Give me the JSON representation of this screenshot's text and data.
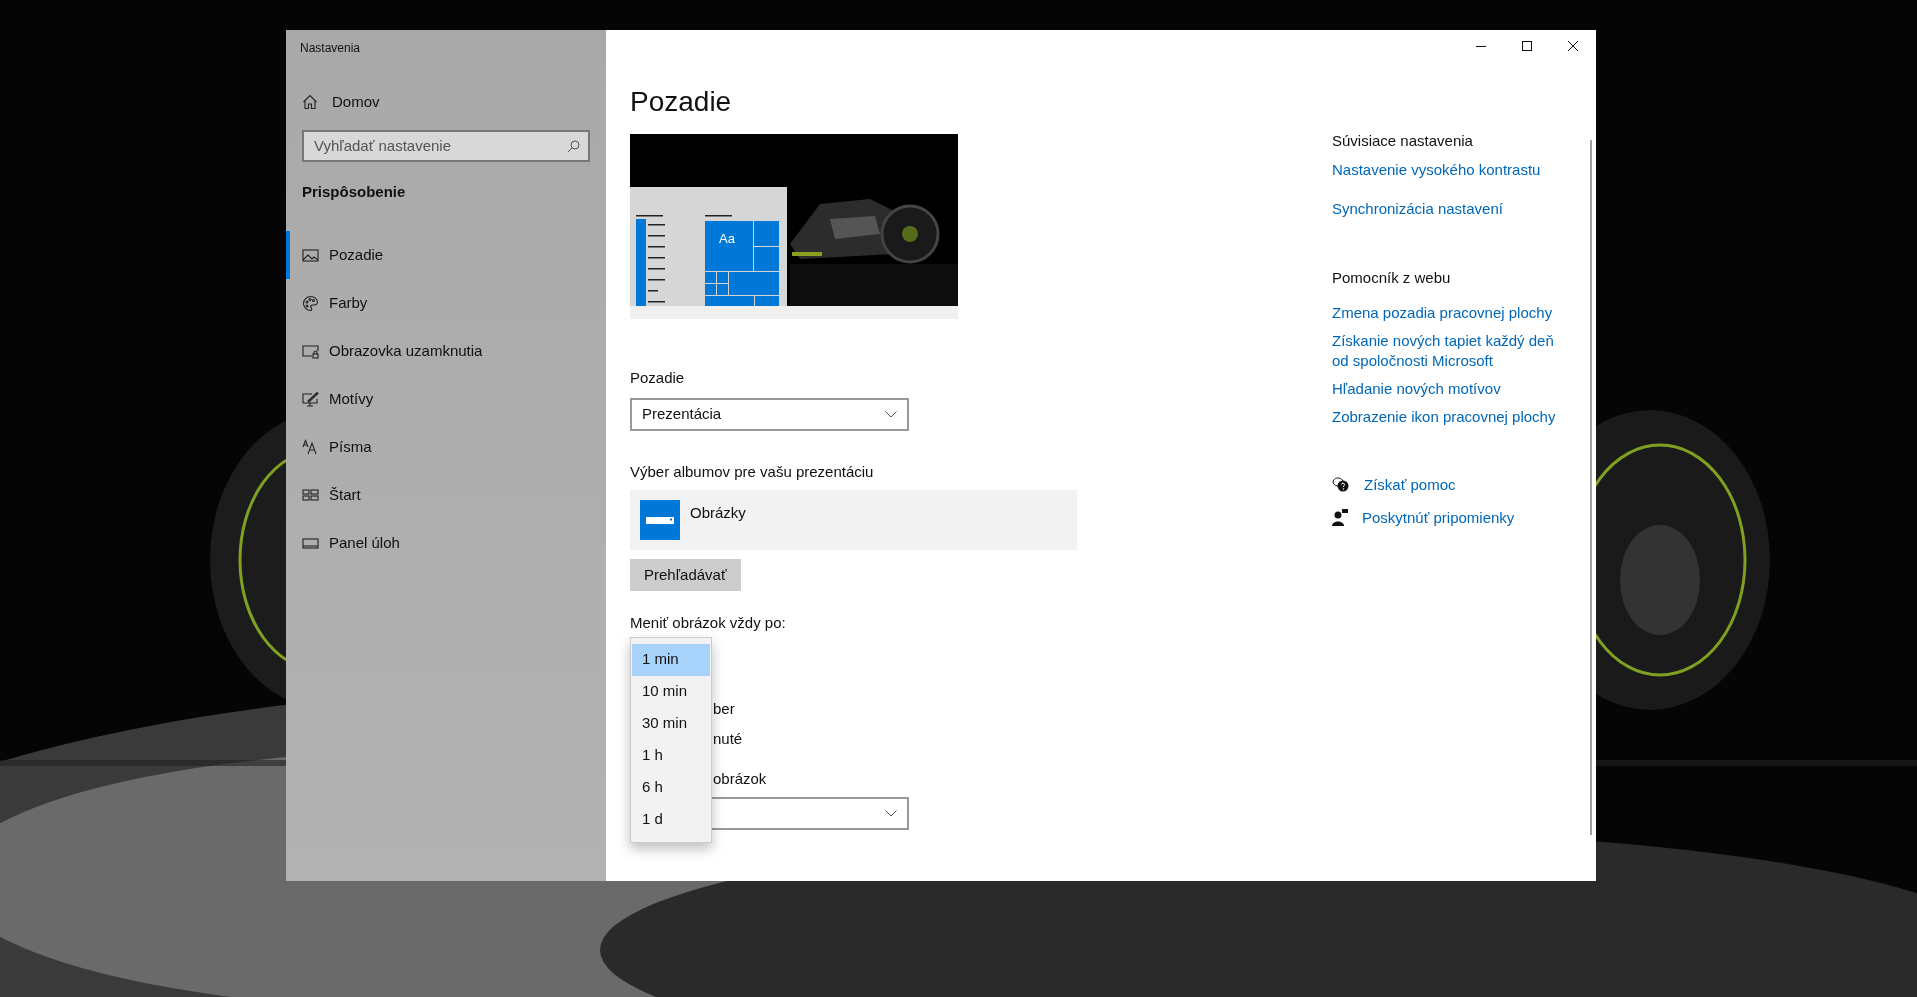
{
  "window": {
    "title": "Nastavenia"
  },
  "sidebar": {
    "home": "Domov",
    "search": {
      "placeholder": "Vyhľadať nastavenie"
    },
    "section": "Prispôsobenie",
    "items": [
      {
        "label": "Pozadie",
        "selected": true
      },
      {
        "label": "Farby",
        "selected": false
      },
      {
        "label": "Obrazovka uzamknutia",
        "selected": false
      },
      {
        "label": "Motívy",
        "selected": false
      },
      {
        "label": "Písma",
        "selected": false
      },
      {
        "label": "Štart",
        "selected": false
      },
      {
        "label": "Panel úloh",
        "selected": false
      }
    ]
  },
  "main": {
    "title": "Pozadie",
    "preview": {
      "tile_text": "Aa"
    },
    "background": {
      "label": "Pozadie",
      "value": "Prezentácia"
    },
    "albums": {
      "label": "Výber albumov pre vašu prezentáciu",
      "items": [
        {
          "name": "Obrázky"
        }
      ],
      "browse_button": "Prehľadávať"
    },
    "interval": {
      "label": "Meniť obrázok vždy po:",
      "options": [
        {
          "label": "1 min",
          "selected": true
        },
        {
          "label": "10 min",
          "selected": false
        },
        {
          "label": "30 min",
          "selected": false
        },
        {
          "label": "1 h",
          "selected": false
        },
        {
          "label": "6 h",
          "selected": false
        },
        {
          "label": "1 d",
          "selected": false
        }
      ]
    },
    "covered_texts": [
      "ber",
      "nuté",
      "obrázok"
    ]
  },
  "related": {
    "heading": "Súvisiace nastavenia",
    "links": [
      "Nastavenie vysokého kontrastu",
      "Synchronizácia nastavení"
    ]
  },
  "web_help": {
    "heading": "Pomocník z webu",
    "links": [
      "Zmena pozadia pracovnej plochy",
      "Získanie nových tapiet každý deň od spoločnosti Microsoft",
      "Hľadanie nových motívov",
      "Zobrazenie ikon pracovnej plochy"
    ]
  },
  "support": [
    "Získať pomoc",
    "Poskytnúť pripomienky"
  ]
}
